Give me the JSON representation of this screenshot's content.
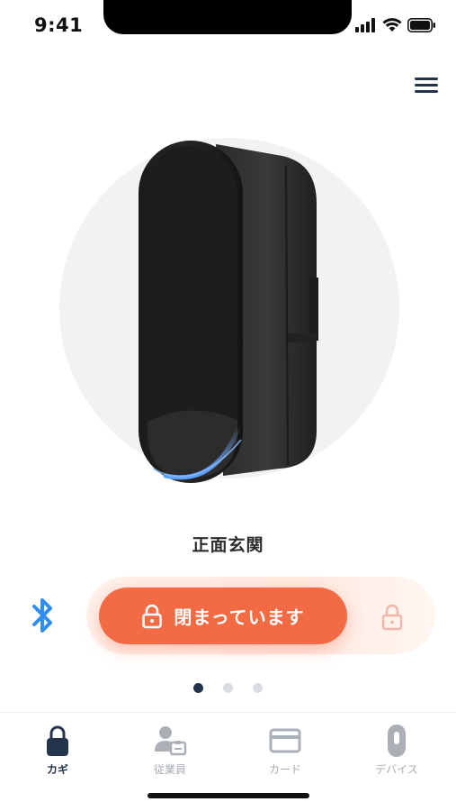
{
  "status_bar": {
    "time": "9:41"
  },
  "lock": {
    "name": "正面玄関",
    "state_label": "閉まっています"
  },
  "pager": {
    "count": 3,
    "active_index": 0
  },
  "tabs": [
    {
      "label": "カギ",
      "icon": "lock-icon",
      "active": true
    },
    {
      "label": "従業員",
      "icon": "employee-icon",
      "active": false
    },
    {
      "label": "カード",
      "icon": "card-icon",
      "active": false
    },
    {
      "label": "デバイス",
      "icon": "device-icon",
      "active": false
    }
  ],
  "colors": {
    "accent": "#f36b45",
    "navy": "#24344a",
    "bluetooth": "#2f8ef0",
    "inactive": "#a7adb3"
  }
}
